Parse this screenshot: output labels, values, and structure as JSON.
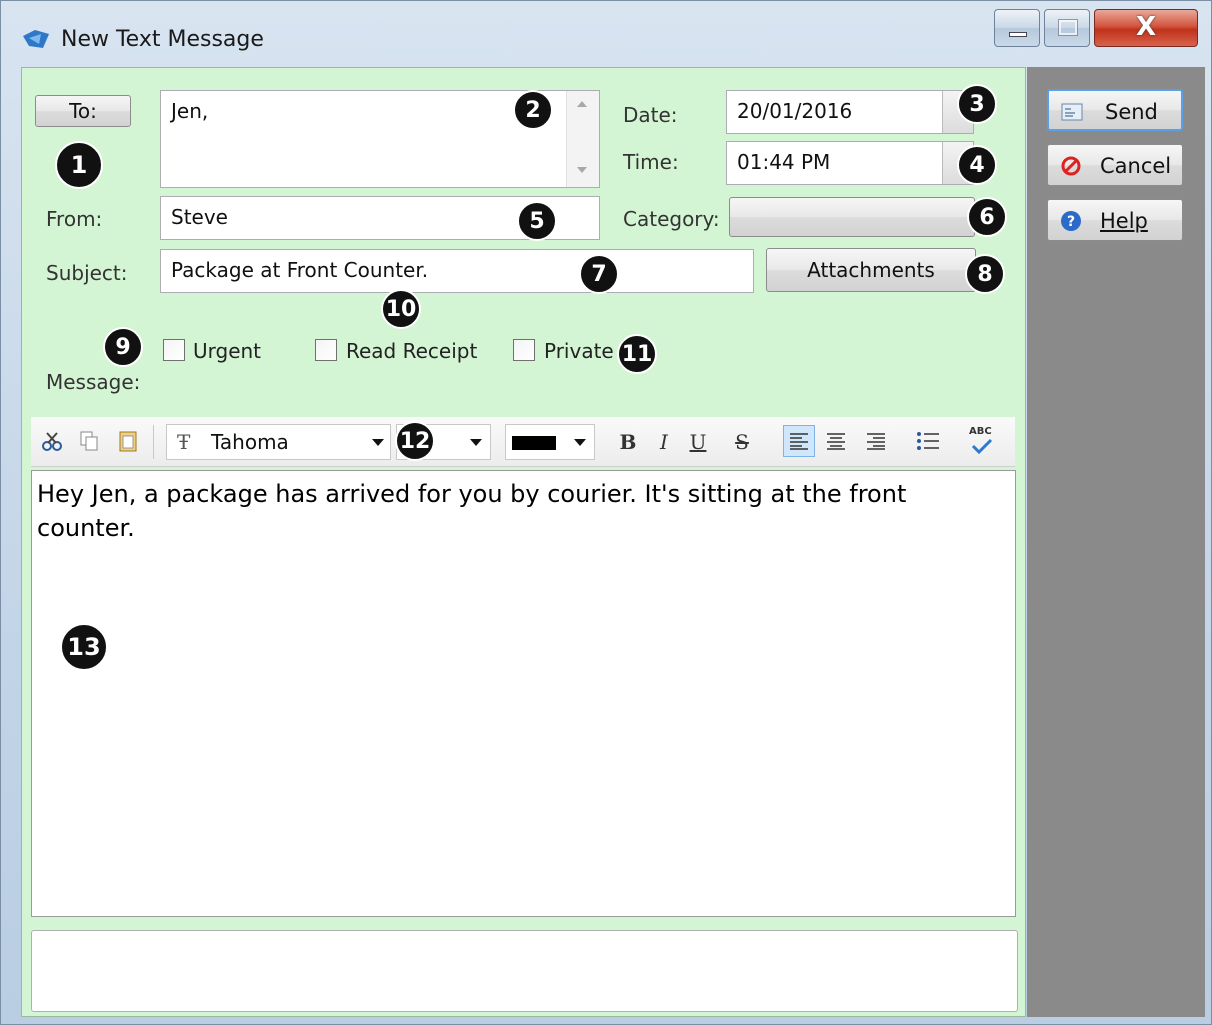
{
  "window": {
    "title": "New Text Message",
    "close_glyph": "X"
  },
  "header": {
    "to_button": "To:",
    "to_value": "Jen,",
    "date_label": "Date:",
    "date_value": "20/01/2016",
    "time_label": "Time:",
    "time_value": "01:44 PM",
    "from_label": "From:",
    "from_value": "Steve",
    "category_label": "Category:",
    "category_value": "",
    "subject_label": "Subject:",
    "subject_value": "Package at Front Counter.",
    "attachments_button": "Attachments",
    "message_label": "Message:"
  },
  "options": {
    "urgent": "Urgent",
    "read_receipt": "Read Receipt",
    "private": "Private"
  },
  "toolbar": {
    "font_name": "Tahoma",
    "font_icon": "Ŧ",
    "bold": "B",
    "italic": "I",
    "underline": "U",
    "strike": "S",
    "spell": "ABC"
  },
  "message": {
    "body": "Hey Jen, a package has arrived for you by courier.  It's sitting at the front counter."
  },
  "sidebar": {
    "send": "Send",
    "cancel": "Cancel",
    "help": "Help"
  },
  "badges": [
    "1",
    "2",
    "3",
    "4",
    "5",
    "6",
    "7",
    "8",
    "9",
    "10",
    "11",
    "12",
    "13"
  ],
  "colors": {
    "form_bg": "#d4f5d4",
    "sidebar_bg": "#8a8a8a",
    "close_red": "#c0321c"
  }
}
